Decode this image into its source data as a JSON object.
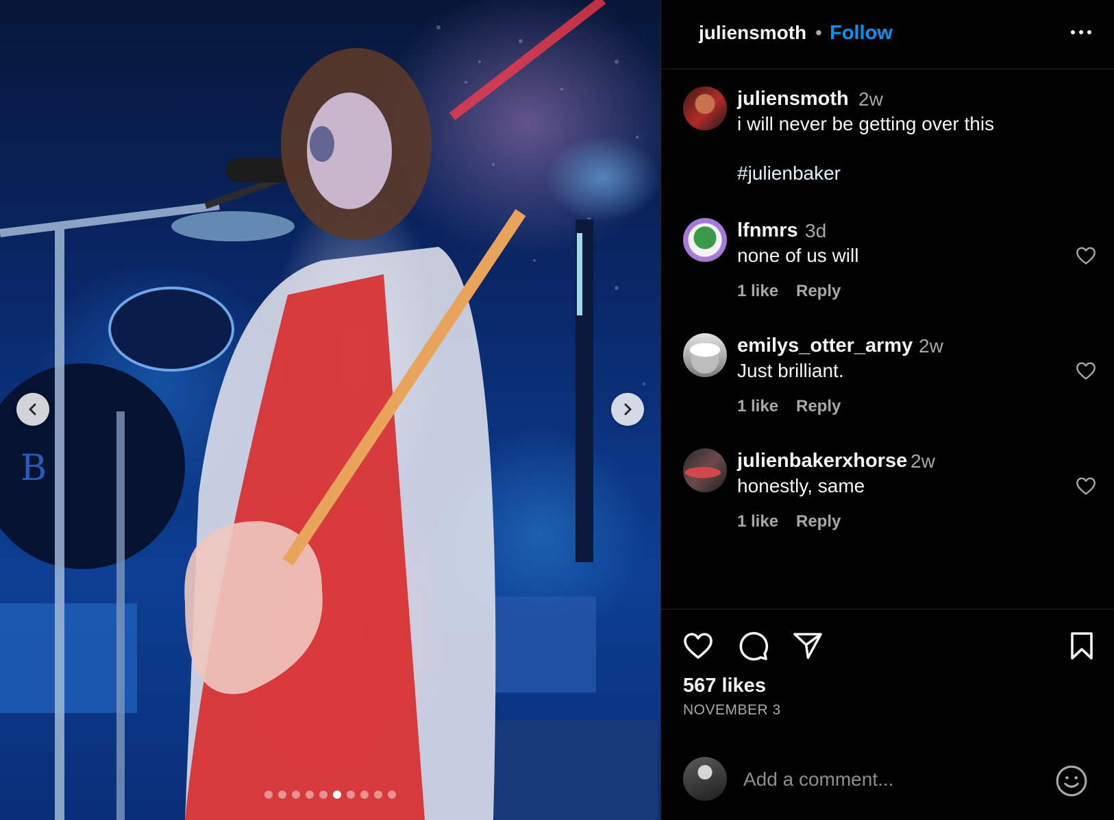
{
  "post": {
    "author": "juliensmoth",
    "follow_label": "Follow",
    "separator": "•",
    "carousel": {
      "slide_count": 10,
      "active_index": 5
    }
  },
  "caption": {
    "username": "juliensmoth",
    "time": "2w",
    "text": "i will never be getting over this",
    "hashtag": "#julienbaker"
  },
  "comments": [
    {
      "username": "lfnmrs",
      "time": "3d",
      "text": "none of us will",
      "likes": "1 like",
      "reply": "Reply"
    },
    {
      "username": "emilys_otter_army",
      "time": "2w",
      "text": "Just brilliant.",
      "likes": "1 like",
      "reply": "Reply"
    },
    {
      "username": "julienbakerxhorse",
      "time": "2w",
      "text": "honestly, same",
      "likes": "1 like",
      "reply": "Reply"
    }
  ],
  "footer": {
    "likes": "567 likes",
    "date": "NOVEMBER 3",
    "comment_placeholder": "Add a comment..."
  },
  "icons": {
    "prev": "chevron-left-icon",
    "next": "chevron-right-icon",
    "like": "heart-icon",
    "comment": "comment-icon",
    "share": "share-icon",
    "save": "bookmark-icon",
    "emoji": "emoji-icon",
    "more": "more-icon"
  },
  "colors": {
    "accent": "#0095f6",
    "background": "#000000",
    "muted": "#a8a8a8"
  }
}
